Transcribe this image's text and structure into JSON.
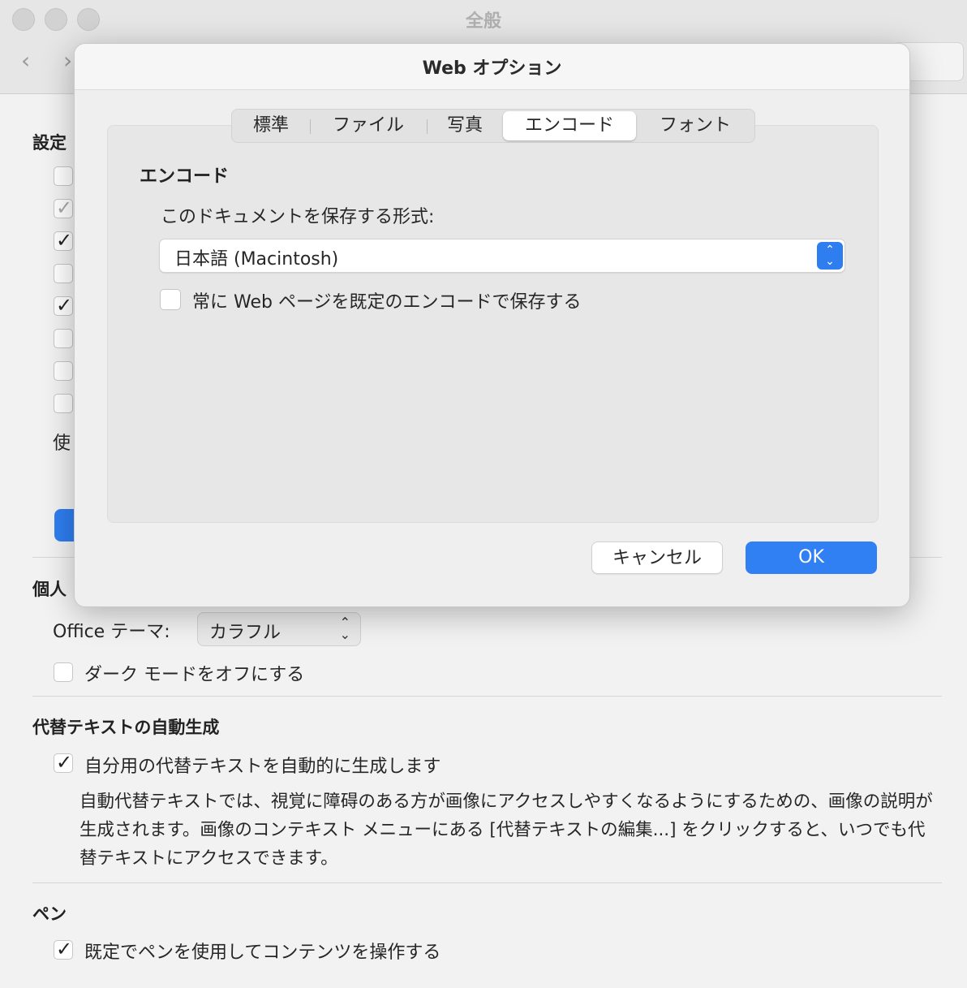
{
  "window": {
    "title": "全般",
    "nav_back": "‹",
    "nav_forward": "›"
  },
  "settings": {
    "heading": "設定",
    "use_label_partial": "使",
    "personal_heading": "個人"
  },
  "personalize": {
    "theme_label": "Office テーマ:",
    "theme_value": "カラフル",
    "dark_mode_label": "ダーク モードをオフにする"
  },
  "alt_text": {
    "heading": "代替テキストの自動生成",
    "checkbox_label": "自分用の代替テキストを自動的に生成します",
    "description": "自動代替テキストでは、視覚に障碍のある方が画像にアクセスしやすくなるようにするための、画像の説明が生成されます。画像のコンテキスト メニューにある [代替テキストの編集...] をクリックすると、いつでも代替テキストにアクセスできます。"
  },
  "pen": {
    "heading": "ペン",
    "checkbox_label": "既定でペンを使用してコンテンツを操作する"
  },
  "dialog": {
    "title": "Web オプション",
    "tabs": [
      "標準",
      "ファイル",
      "写真",
      "エンコード",
      "フォント"
    ],
    "active_tab": "エンコード",
    "section_title": "エンコード",
    "save_format_label": "このドキュメントを保存する形式:",
    "encoding_value": "日本語 (Macintosh)",
    "always_default_label": "常に Web ページを既定のエンコードで保存する",
    "cancel_label": "キャンセル",
    "ok_label": "OK"
  },
  "colors": {
    "accent": "#3180f3",
    "background": "#f2f2f2",
    "dialog": "#efefef"
  }
}
